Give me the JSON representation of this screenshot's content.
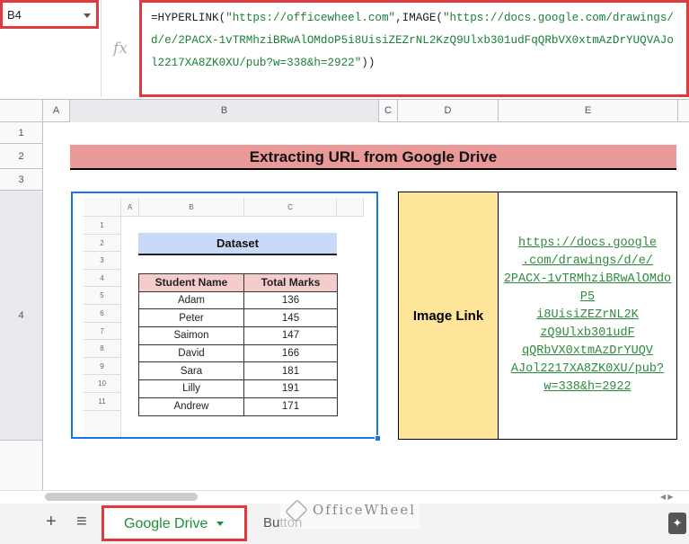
{
  "name_box": {
    "value": "B4"
  },
  "formula_bar": {
    "fx_label": "fx",
    "prefix": "=HYPERLINK(",
    "arg1": "\"https://officewheel.com\"",
    "mid": ",IMAGE(",
    "arg2": "\"https://docs.google.com/drawings/d/e/2PACX-1vTRMhziBRwAlOMdoP5i8UisiZEZrNL2KzQ9Ulxb301udFqQRbVX0xtmAzDrYUQVAJol2217XA8ZK0XU/pub?w=338&h=2922\"",
    "suffix": "))"
  },
  "columns": [
    "A",
    "B",
    "C",
    "D",
    "E"
  ],
  "rows": [
    "1",
    "2",
    "3",
    "4"
  ],
  "title": "Extracting URL from Google Drive",
  "d4_label": "Image Link",
  "e4_link_lines": [
    "https://docs.google",
    ".com/drawings/d/e/",
    "2PACX-1vTRMhziBRwAlOMdo",
    "P5",
    "i8UisiZEZrNL2K",
    "zQ9Ulxb301udF",
    "qQRbVX0xtmAzDrYUQV",
    "AJol2217XA8ZK0XU/pub?",
    "w=338&h=2922"
  ],
  "embedded_image": {
    "columns": [
      "A",
      "B",
      "C"
    ],
    "rows": [
      "1",
      "2",
      "3",
      "4",
      "5",
      "6",
      "7",
      "8",
      "9",
      "10",
      "11"
    ],
    "dataset_title": "Dataset",
    "headers": [
      "Student Name",
      "Total Marks"
    ],
    "data": [
      [
        "Adam",
        "136"
      ],
      [
        "Peter",
        "145"
      ],
      [
        "Saimon",
        "147"
      ],
      [
        "David",
        "166"
      ],
      [
        "Sara",
        "181"
      ],
      [
        "Lilly",
        "191"
      ],
      [
        "Andrew",
        "171"
      ]
    ]
  },
  "tabs": {
    "add": "+",
    "list": "≡",
    "active": "Google Drive",
    "second": "Button"
  },
  "watermark": "OfficeWheel"
}
